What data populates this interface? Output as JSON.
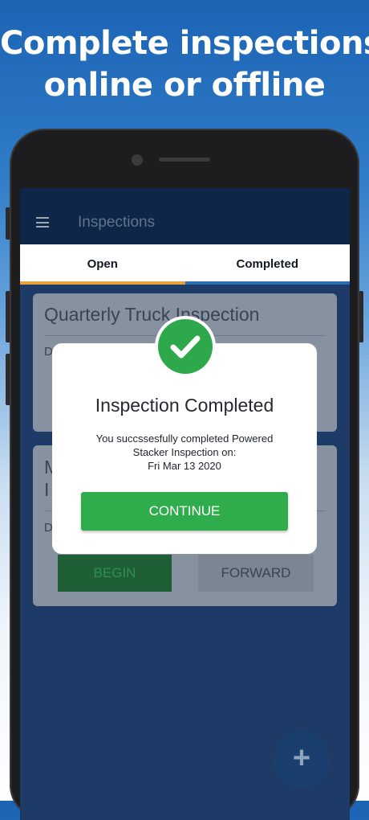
{
  "headline": {
    "line1": "Complete inspections",
    "line2": "online or offline"
  },
  "app": {
    "title": "Inspections",
    "menu_icon": "hamburger-menu-icon"
  },
  "tabs": [
    {
      "label": "Open",
      "active": true
    },
    {
      "label": "Completed",
      "active": false
    }
  ],
  "cards": [
    {
      "title": "Quarterly Truck Inspection",
      "date_prefix": "D"
    },
    {
      "title_line1": "M",
      "title_line2": "I",
      "date_prefix": "D",
      "begin_label": "BEGIN",
      "forward_label": "FORWARD"
    }
  ],
  "modal": {
    "icon": "checkmark-icon",
    "title": "Inspection Completed",
    "message_line1": "You succssesfully completed Powered",
    "message_line2": "Stacker Inspection on:",
    "message_line3": "Fri Mar 13 2020",
    "continue_label": "CONTINUE"
  },
  "fab": {
    "label": "+",
    "icon": "plus-icon"
  },
  "colors": {
    "accent_green": "#2fad4d",
    "tab_open_underline": "#e8a33c",
    "tab_completed_underline": "#2c6cb1",
    "appbar": "#0e2748"
  }
}
